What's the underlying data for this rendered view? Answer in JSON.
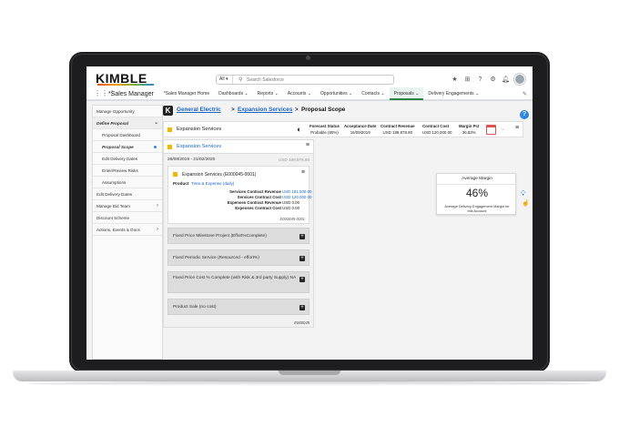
{
  "brand": {
    "logo_text": "KIMBLE"
  },
  "header": {
    "search_scope": "All",
    "search_placeholder": "Search Salesforce",
    "icons": [
      "star-icon",
      "add-icon",
      "help-icon",
      "settings-icon",
      "bell-icon",
      "avatar"
    ]
  },
  "nav": {
    "app_name": "*Sales Manager",
    "items": [
      {
        "label": "*Sales Manager Home"
      },
      {
        "label": "Dashboards ⌄"
      },
      {
        "label": "Reports ⌄"
      },
      {
        "label": "Accounts ⌄"
      },
      {
        "label": "Opportunities ⌄"
      },
      {
        "label": "Contacts ⌄"
      },
      {
        "label": "Proposals ⌄"
      },
      {
        "label": "Delivery Engagements ⌄"
      }
    ],
    "active_index": 6
  },
  "sidebar": {
    "items": [
      {
        "label": "Manage Opportunity"
      },
      {
        "label": "Define Proposal"
      },
      {
        "label": "Proposal Dashboard"
      },
      {
        "label": "Proposal Scope"
      },
      {
        "label": "Edit Delivery Dates"
      },
      {
        "label": "Enter/Review Risks"
      },
      {
        "label": "Assumptions"
      },
      {
        "label": "Edit Delivery Dates"
      },
      {
        "label": "Manage Bid Team"
      },
      {
        "label": "Discount Scheme"
      },
      {
        "label": "Actions, Events & Docs"
      }
    ]
  },
  "breadcrumb": {
    "account": "General Electric",
    "sep1": ">",
    "opportunity": "Expansion Services",
    "sep2": ">",
    "page": "Proposal Scope"
  },
  "summary": {
    "title": "Expansion Services",
    "metrics": [
      {
        "label": "Forecast Status",
        "value": "Probable (90%)"
      },
      {
        "label": "Acceptance Date",
        "value": "16/09/2019"
      },
      {
        "label": "Contract Revenue",
        "value": "USD 189,978.80"
      },
      {
        "label": "Contract Cost",
        "value": "USD 120,000.00"
      },
      {
        "label": "Margin Pct",
        "value": "36.83%"
      }
    ]
  },
  "panel": {
    "title": "Expansion Services",
    "date_range": "26/08/2019 - 21/02/2020",
    "amount": "USD 189,978.80",
    "card": {
      "title": "Expansion Services (E000045-0001)",
      "product_label": "Product",
      "product_value": "Time & Expense (daily)",
      "financials": [
        {
          "label": "Services Contract Revenue",
          "value": "USD 191,500.00",
          "blue": true
        },
        {
          "label": "Services Contract Cost",
          "value": "USD 120,000.00",
          "blue": true
        },
        {
          "label": "Expenses Contract Revenue",
          "value": "USD 0.00",
          "blue": false
        },
        {
          "label": "Expenses Contract Cost",
          "value": "USD 0.00",
          "blue": false
        }
      ],
      "ref": "E000045-0001"
    },
    "bars": [
      {
        "label": "Fixed Price Milestone Project (Effort%Complete)"
      },
      {
        "label": "Fixed Periodic Service (Resourced - effort%)"
      },
      {
        "label": "Fixed Price Cost % Complete (with Risk & 3rd party Supply) NA"
      },
      {
        "label": "Product Sale (no cost)"
      }
    ],
    "ref": "E000045"
  },
  "margin_card": {
    "title": "Average Margin",
    "value": "46%",
    "description": "Average Delivery Engagement Margin for this Account"
  }
}
